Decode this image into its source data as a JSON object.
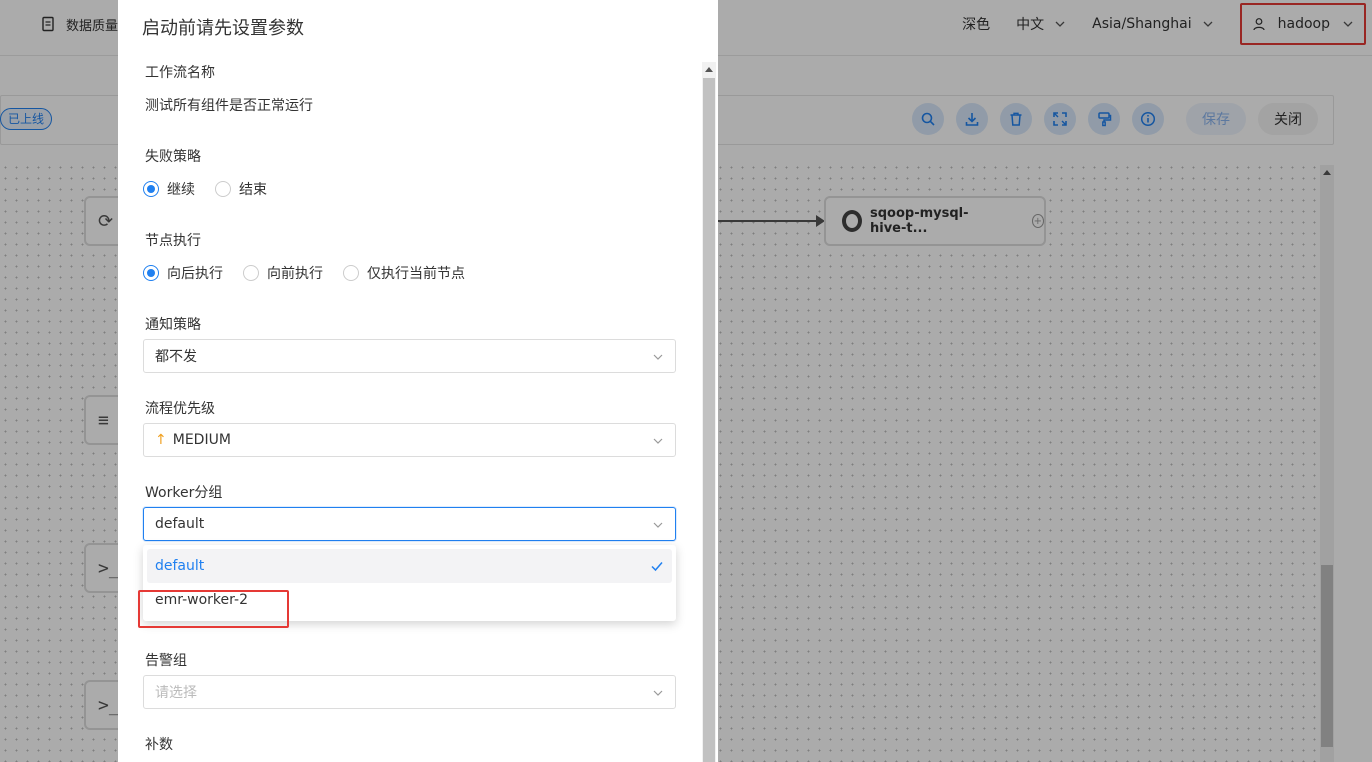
{
  "topbar": {
    "menu_label": "数据质量",
    "theme": "深色",
    "language": "中文",
    "timezone": "Asia/Shanghai",
    "user": "hadoop"
  },
  "workflow_toolbar": {
    "status_badge": "已上线",
    "icons": [
      "search-icon",
      "download-icon",
      "delete-icon",
      "fullscreen-icon",
      "format-icon",
      "info-icon"
    ],
    "save_label": "保存",
    "close_label": "关闭"
  },
  "canvas": {
    "node_label": "sqoop-mysql-hive-t..."
  },
  "modal": {
    "title": "启动前请先设置参数",
    "workflow_name_label": "工作流名称",
    "workflow_name_value": "测试所有组件是否正常运行",
    "failure_strategy_label": "失败策略",
    "failure_options": [
      "继续",
      "结束"
    ],
    "failure_selected": "继续",
    "node_exec_label": "节点执行",
    "node_exec_options": [
      "向后执行",
      "向前执行",
      "仅执行当前节点"
    ],
    "node_exec_selected": "向后执行",
    "notify_label": "通知策略",
    "notify_value": "都不发",
    "priority_label": "流程优先级",
    "priority_value": "MEDIUM",
    "priority_color": "#f0a020",
    "worker_label": "Worker分组",
    "worker_value": "default",
    "worker_options": [
      "default",
      "emr-worker-2"
    ],
    "alarm_label": "告警组",
    "alarm_placeholder": "请选择",
    "complement_label": "补数"
  },
  "colors": {
    "accent": "#2080f0",
    "highlight_box": "#e53935"
  }
}
